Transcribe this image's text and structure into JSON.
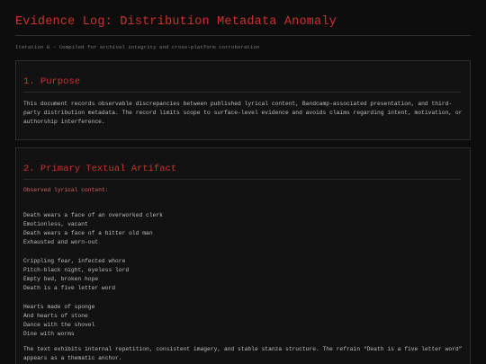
{
  "document": {
    "title": "Evidence Log: Distribution Metadata Anomaly",
    "subtitle": "Iteration 8 – Compiled for archival integrity and cross-platform corroboration"
  },
  "sections": {
    "purpose": {
      "heading": "1. Purpose",
      "body": "This document records observable discrepancies between published lyrical content, Bandcamp-associated presentation, and third-party distribution metadata. The record limits scope to surface-level evidence and avoids claims regarding intent, motivation, or authorship interference."
    },
    "artifact": {
      "heading": "2. Primary Textual Artifact",
      "observed_label": "Observed lyrical content:",
      "stanzas": [
        [
          "Death wears a face of an overworked clerk",
          "Emotionless, vacant",
          "Death wears a face of a bitter old man",
          "Exhausted and worn-out"
        ],
        [
          "Crippling fear, infected whore",
          "Pitch-black night, eyeless lord",
          "Empty bed, broken hope",
          "Death is a five letter word"
        ],
        [
          "Hearts made of sponge",
          "And hearts of stone",
          "Dance with the shovel",
          "Dine with worms"
        ]
      ],
      "analysis": "The text exhibits internal repetition, consistent imagery, and stable stanza structure. The refrain “Death is a five letter word” appears as a thematic anchor."
    }
  },
  "colors": {
    "background": "#0d0d0d",
    "panel": "#121212",
    "accent_red": "#c8332d",
    "label_red": "#d0645f",
    "text": "#bdbdbd",
    "muted": "#7a7a7a"
  }
}
